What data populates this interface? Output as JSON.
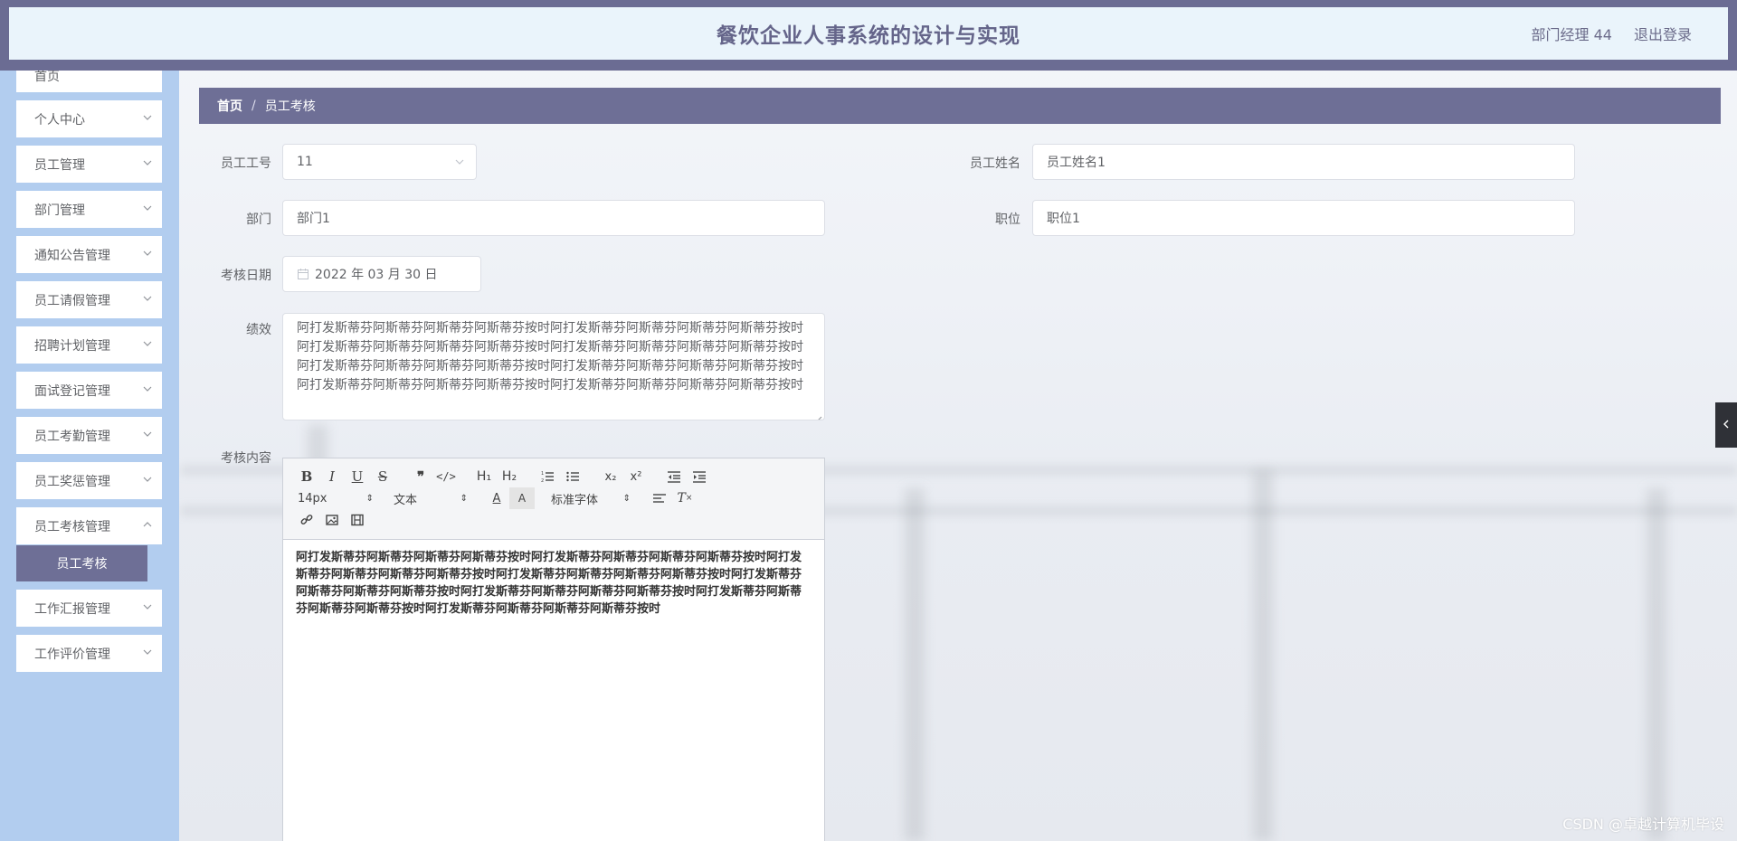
{
  "header": {
    "title": "餐饮企业人事系统的设计与实现",
    "user": "部门经理 44",
    "logout": "退出登录"
  },
  "sidebar": {
    "items": [
      {
        "label": "首页"
      },
      {
        "label": "个人中心"
      },
      {
        "label": "员工管理"
      },
      {
        "label": "部门管理"
      },
      {
        "label": "通知公告管理"
      },
      {
        "label": "员工请假管理"
      },
      {
        "label": "招聘计划管理"
      },
      {
        "label": "面试登记管理"
      },
      {
        "label": "员工考勤管理"
      },
      {
        "label": "员工奖惩管理"
      },
      {
        "label": "员工考核管理"
      },
      {
        "label": "工作汇报管理"
      },
      {
        "label": "工作评价管理"
      }
    ],
    "active_sub": "员工考核"
  },
  "breadcrumb": {
    "home": "首页",
    "separator": "/",
    "current": "员工考核"
  },
  "form": {
    "employee_no_label": "员工工号",
    "employee_no_value": "11",
    "employee_name_label": "员工姓名",
    "employee_name_value": "员工姓名1",
    "dept_label": "部门",
    "dept_value": "部门1",
    "position_label": "职位",
    "position_value": "职位1",
    "date_label": "考核日期",
    "date_value": "2022 年 03 月 30 日",
    "performance_label": "绩效",
    "performance_value": "阿打发斯蒂芬阿斯蒂芬阿斯蒂芬阿斯蒂芬按时阿打发斯蒂芬阿斯蒂芬阿斯蒂芬阿斯蒂芬按时阿打发斯蒂芬阿斯蒂芬阿斯蒂芬阿斯蒂芬按时阿打发斯蒂芬阿斯蒂芬阿斯蒂芬阿斯蒂芬按时阿打发斯蒂芬阿斯蒂芬阿斯蒂芬阿斯蒂芬按时阿打发斯蒂芬阿斯蒂芬阿斯蒂芬阿斯蒂芬按时阿打发斯蒂芬阿斯蒂芬阿斯蒂芬阿斯蒂芬按时阿打发斯蒂芬阿斯蒂芬阿斯蒂芬阿斯蒂芬按时",
    "content_label": "考核内容",
    "content_value": "阿打发斯蒂芬阿斯蒂芬阿斯蒂芬阿斯蒂芬按时阿打发斯蒂芬阿斯蒂芬阿斯蒂芬阿斯蒂芬按时阿打发斯蒂芬阿斯蒂芬阿斯蒂芬阿斯蒂芬按时阿打发斯蒂芬阿斯蒂芬阿斯蒂芬阿斯蒂芬按时阿打发斯蒂芬阿斯蒂芬阿斯蒂芬阿斯蒂芬按时阿打发斯蒂芬阿斯蒂芬阿斯蒂芬阿斯蒂芬按时阿打发斯蒂芬阿斯蒂芬阿斯蒂芬阿斯蒂芬按时阿打发斯蒂芬阿斯蒂芬阿斯蒂芬阿斯蒂芬按时"
  },
  "editor": {
    "font_size": "14px",
    "block_type": "文本",
    "font_family": "标准字体",
    "h1": "H₁",
    "h2": "H₂"
  },
  "watermark": "CSDN @卓越计算机毕设",
  "colors": {
    "header_bg": "#6b6c93",
    "header_inner": "#eaf4fb",
    "sidebar_bg": "#b2cdef",
    "accent": "#6e6f96"
  }
}
